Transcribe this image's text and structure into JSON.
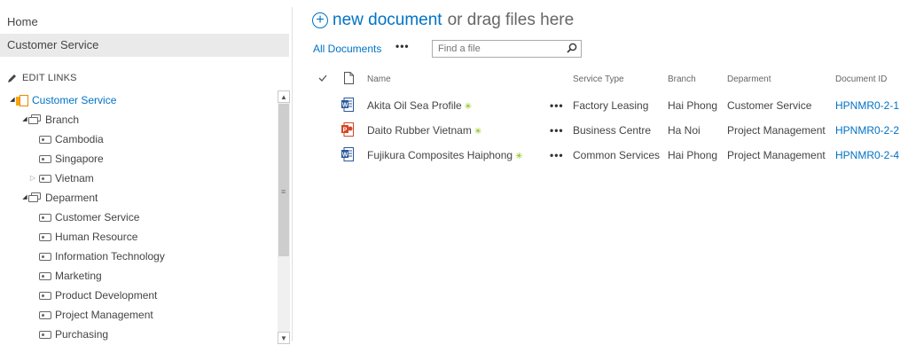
{
  "nav": {
    "quick_links": [
      "Home",
      "Customer Service"
    ],
    "edit_links": "EDIT LINKS",
    "tree": {
      "root": "Customer Service",
      "branch": "Branch",
      "branch_items": [
        "Cambodia",
        "Singapore",
        "Vietnam"
      ],
      "department": "Deparment",
      "department_items": [
        "Customer Service",
        "Human Resource",
        "Information Technology",
        "Marketing",
        "Product Development",
        "Project Management",
        "Purchasing"
      ]
    }
  },
  "main": {
    "new_document": "new document",
    "drag_text": "or drag files here",
    "view_name": "All Documents",
    "view_more": "•••",
    "search_placeholder": "Find a file",
    "columns": {
      "name": "Name",
      "service_type": "Service Type",
      "branch": "Branch",
      "department": "Deparment",
      "document_id": "Document ID"
    },
    "rows": [
      {
        "name": "Akita Oil Sea Profile",
        "type": "word",
        "service_type": "Factory Leasing",
        "branch": "Hai Phong",
        "department": "Customer Service",
        "document_id": "HPNMR0-2-1"
      },
      {
        "name": "Daito Rubber Vietnam",
        "type": "powerpoint",
        "service_type": "Business Centre",
        "branch": "Ha Noi",
        "department": "Project Management",
        "document_id": "HPNMR0-2-2"
      },
      {
        "name": "Fujikura Composites Haiphong",
        "type": "word",
        "service_type": "Common Services",
        "branch": "Hai Phong",
        "department": "Project Management",
        "document_id": "HPNMR0-2-4"
      }
    ]
  },
  "colors": {
    "accent": "#0072c6",
    "new_badge": "#7fba00",
    "word": "#2b579a",
    "powerpoint": "#d24726"
  }
}
